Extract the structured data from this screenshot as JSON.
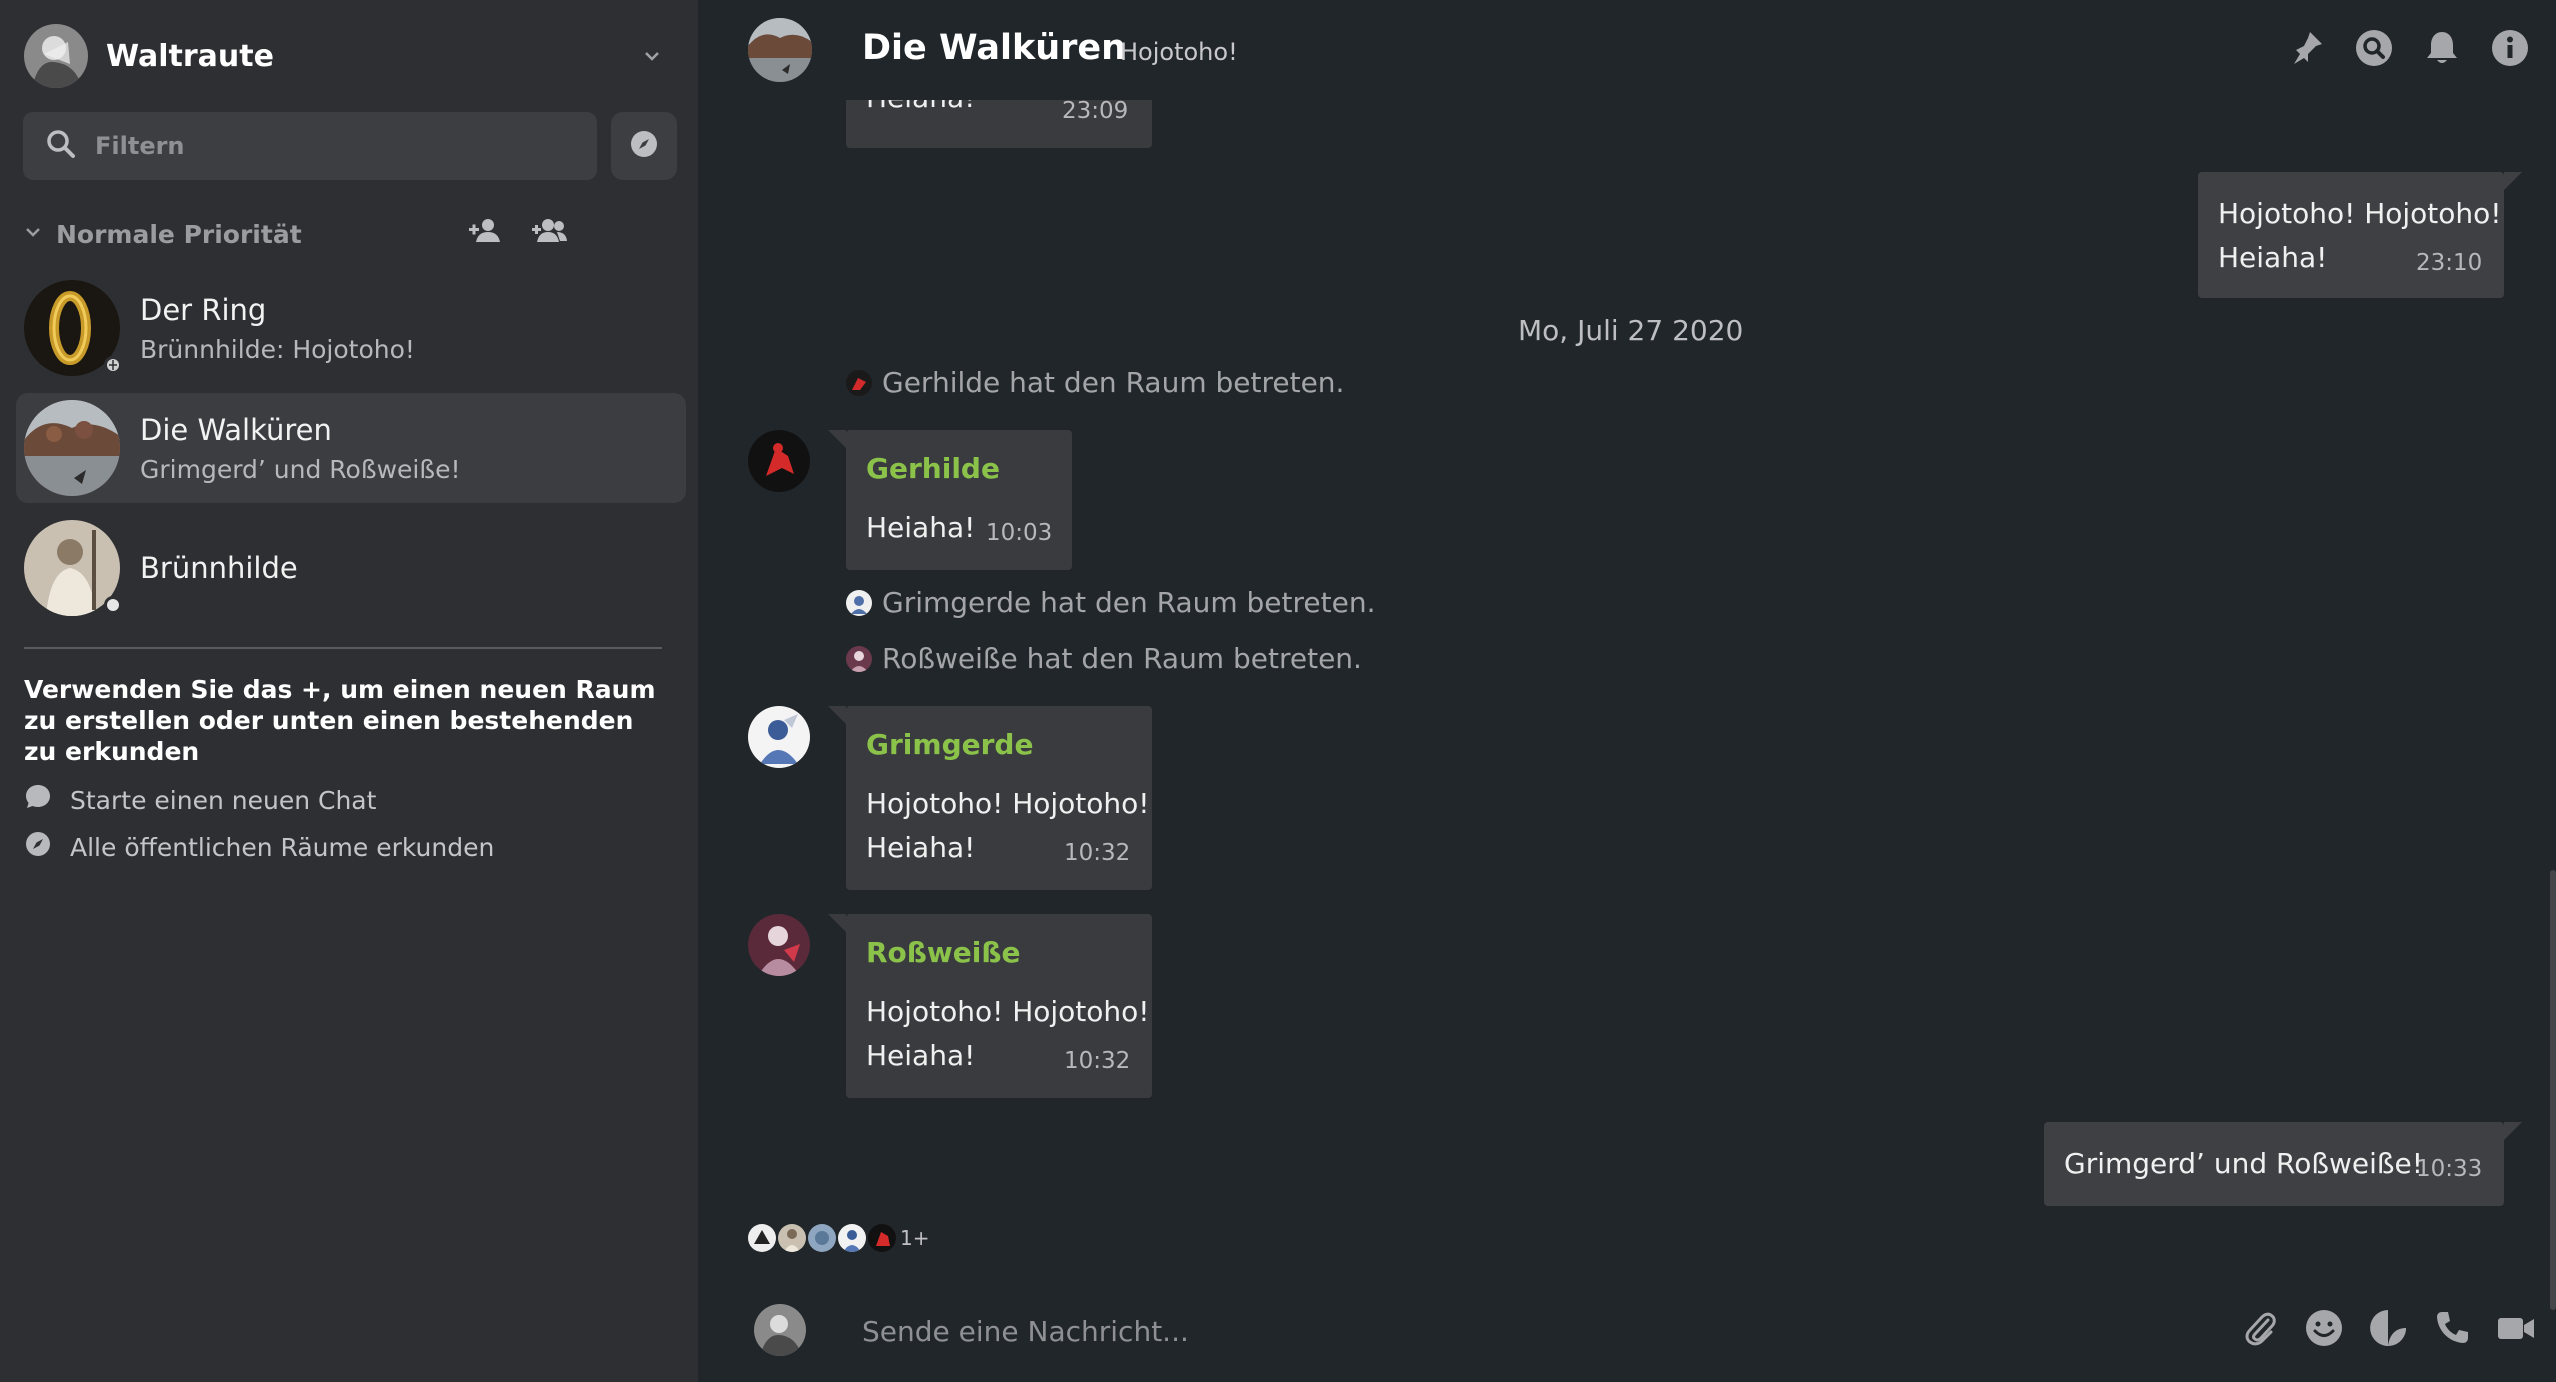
{
  "account": {
    "name": "Waltraute"
  },
  "filter": {
    "placeholder": "Filtern"
  },
  "section": {
    "title": "Normale Priorität"
  },
  "rooms": [
    {
      "name": "Der Ring",
      "preview": "Brünnhilde: Hojotoho!"
    },
    {
      "name": "Die Walküren",
      "preview": "Grimgerd’ und Roßweiße!"
    },
    {
      "name": "Brünnhilde",
      "preview": ""
    }
  ],
  "hint": {
    "text": "Verwenden Sie das +, um einen neuen Raum zu erstellen oder unten einen bestehenden zu erkunden",
    "new_chat": "Starte einen neuen Chat",
    "explore": "Alle öffentlichen Räume erkunden"
  },
  "header": {
    "title": "Die Walküren",
    "topic": "Hojotoho!"
  },
  "timeline": {
    "partial_msg": {
      "text": "Heiaha!",
      "time": "23:09"
    },
    "own_msg_1": {
      "line1": "Hojotoho! Hojotoho!",
      "line2": "Heiaha!",
      "time": "23:10"
    },
    "date": "Mo, Juli 27 2020",
    "event_gerhilde": "Gerhilde hat den Raum betreten.",
    "msg_gerhilde": {
      "sender": "Gerhilde",
      "text": "Heiaha!",
      "time": "10:03"
    },
    "event_grimgerde": "Grimgerde hat den Raum betreten.",
    "event_rossweisse": "Roßweiße hat den Raum betreten.",
    "msg_grimgerde": {
      "sender": "Grimgerde",
      "line1": "Hojotoho! Hojotoho!",
      "line2": "Heiaha!",
      "time": "10:32"
    },
    "msg_rossweisse": {
      "sender": "Roßweiße",
      "line1": "Hojotoho! Hojotoho!",
      "line2": "Heiaha!",
      "time": "10:32"
    },
    "own_msg_2": {
      "text": "Grimgerd’ und Roßweiße!",
      "time": "10:33"
    },
    "read_more": "1+"
  },
  "composer": {
    "placeholder": "Sende eine Nachricht..."
  },
  "colors": {
    "accent_sender": "#8bc34a",
    "sidebar_bg": "#2e2f33",
    "main_bg": "#21262a",
    "bubble": "#3a3b3f"
  },
  "icons": [
    "chevron-down-icon",
    "search-icon",
    "compass-icon",
    "add-person-icon",
    "add-group-icon",
    "pin-icon",
    "bell-icon",
    "info-icon",
    "chat-bubble-icon",
    "paperclip-icon",
    "emoji-icon",
    "sticker-icon",
    "phone-icon",
    "video-icon"
  ]
}
